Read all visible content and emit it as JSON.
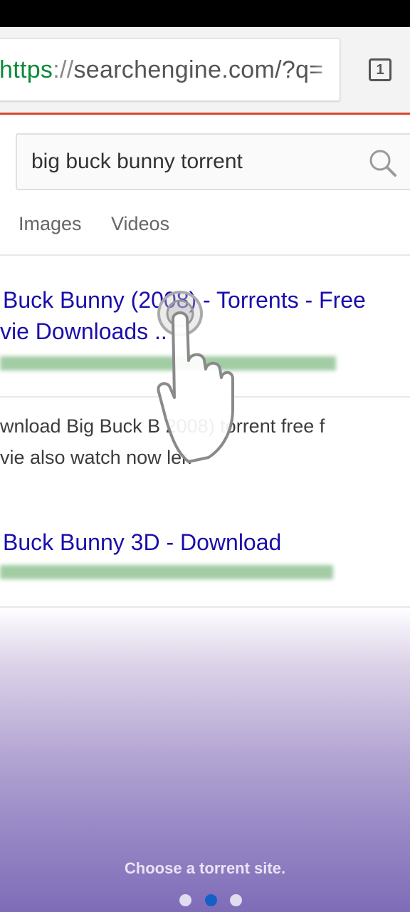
{
  "browser": {
    "url_scheme": "https",
    "url_separator": "://",
    "url_rest": "searchengine.com/?q=",
    "tab_count": "1"
  },
  "search": {
    "query": "big buck bunny torrent"
  },
  "tabs": [
    "Images",
    "Videos"
  ],
  "results": [
    {
      "title_line1": "Buck Bunny (2008) - Torrents - Free",
      "title_line2": "vie Downloads ..",
      "snippet_line1": "wnload Big Buck B        2008) torrent free f",
      "snippet_line2": "vie also watch now        ler."
    },
    {
      "title_line1": "Buck Bunny 3D - Download"
    }
  ],
  "tutorial": {
    "caption": "Choose a torrent site.",
    "page_count": 3,
    "active_page": 1
  },
  "colors": {
    "link": "#1a0dab",
    "accent": "#d9472b",
    "url_green": "#0a8a3a",
    "gradient_bottom": "#7f6cb8",
    "dot_active": "#1560c7"
  }
}
